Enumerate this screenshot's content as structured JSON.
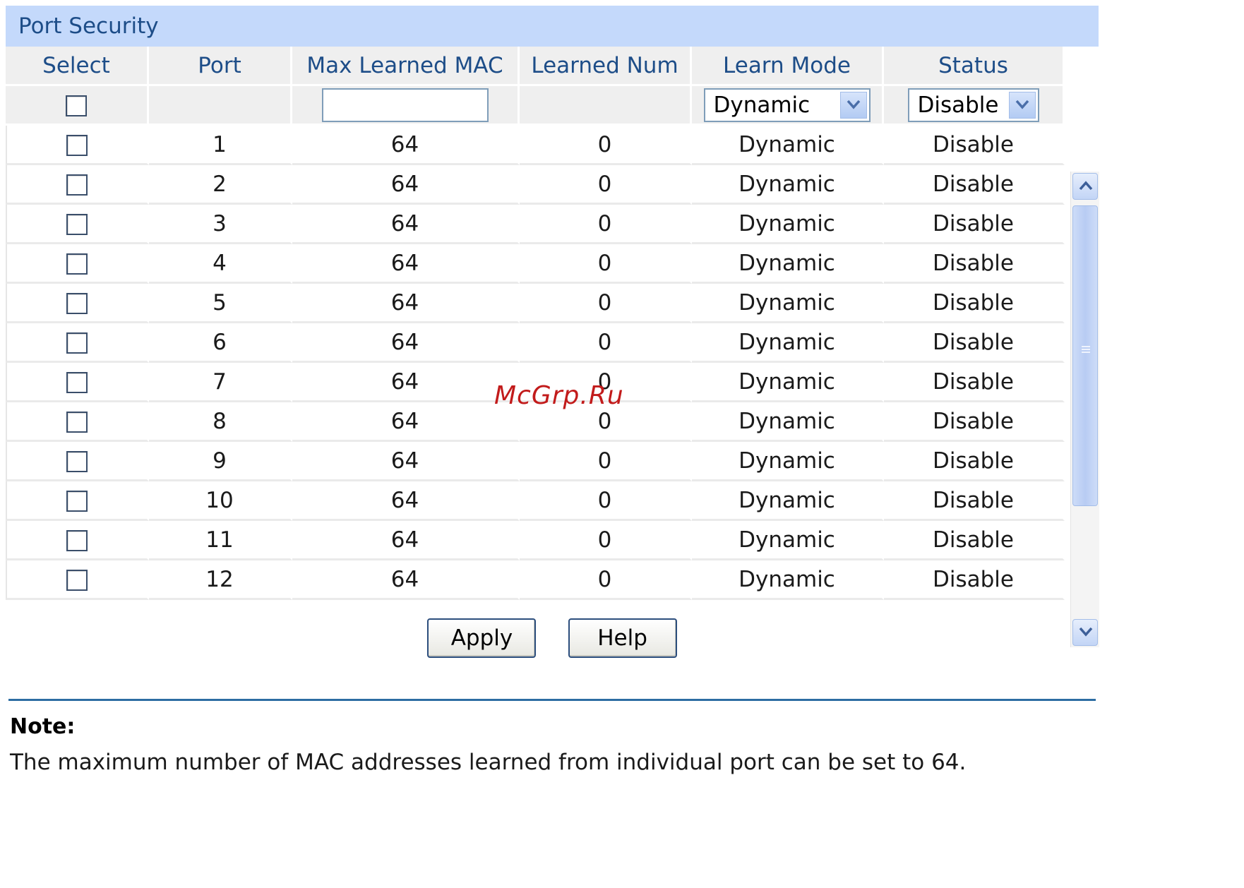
{
  "panel": {
    "title": "Port Security"
  },
  "columns": [
    "Select",
    "Port",
    "Max Learned MAC",
    "Learned Num",
    "Learn Mode",
    "Status"
  ],
  "controls": {
    "max_learned_mac_value": "",
    "learn_mode_selected": "Dynamic",
    "status_selected": "Disable"
  },
  "rows": [
    {
      "port": "1",
      "max": "64",
      "learned": "0",
      "mode": "Dynamic",
      "status": "Disable"
    },
    {
      "port": "2",
      "max": "64",
      "learned": "0",
      "mode": "Dynamic",
      "status": "Disable"
    },
    {
      "port": "3",
      "max": "64",
      "learned": "0",
      "mode": "Dynamic",
      "status": "Disable"
    },
    {
      "port": "4",
      "max": "64",
      "learned": "0",
      "mode": "Dynamic",
      "status": "Disable"
    },
    {
      "port": "5",
      "max": "64",
      "learned": "0",
      "mode": "Dynamic",
      "status": "Disable"
    },
    {
      "port": "6",
      "max": "64",
      "learned": "0",
      "mode": "Dynamic",
      "status": "Disable"
    },
    {
      "port": "7",
      "max": "64",
      "learned": "0",
      "mode": "Dynamic",
      "status": "Disable"
    },
    {
      "port": "8",
      "max": "64",
      "learned": "0",
      "mode": "Dynamic",
      "status": "Disable"
    },
    {
      "port": "9",
      "max": "64",
      "learned": "0",
      "mode": "Dynamic",
      "status": "Disable"
    },
    {
      "port": "10",
      "max": "64",
      "learned": "0",
      "mode": "Dynamic",
      "status": "Disable"
    },
    {
      "port": "11",
      "max": "64",
      "learned": "0",
      "mode": "Dynamic",
      "status": "Disable"
    },
    {
      "port": "12",
      "max": "64",
      "learned": "0",
      "mode": "Dynamic",
      "status": "Disable"
    }
  ],
  "buttons": {
    "apply": "Apply",
    "help": "Help"
  },
  "note": {
    "label": "Note:",
    "text": "The maximum number of MAC addresses learned from individual port can be set to 64."
  },
  "watermark": "McGrp.Ru",
  "colors": {
    "title_bg": "#c4d9fb",
    "header_text": "#1d4d88",
    "divider": "#2d6da3"
  },
  "icons": {
    "select_arrow": "chevron-down-icon",
    "scroll_up": "chevron-up-icon",
    "scroll_down": "chevron-down-icon"
  }
}
